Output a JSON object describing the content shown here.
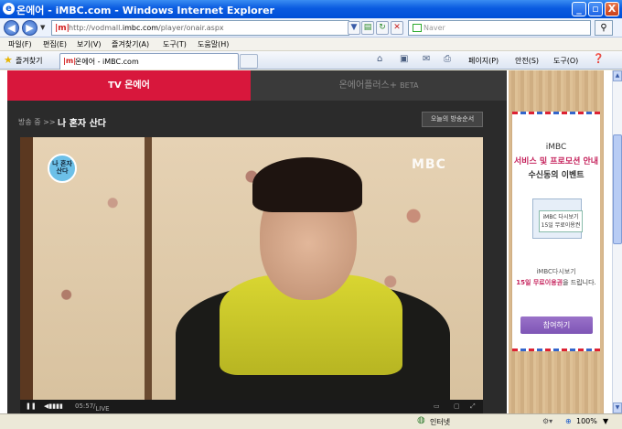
{
  "window": {
    "title": "온에어 - iMBC.com - Windows Internet Explorer",
    "minimize": "_",
    "maximize": "▫",
    "close": "X"
  },
  "address": {
    "url_prefix": "http://vodmall.",
    "url_domain": "imbc.com",
    "url_path": "/player/onair.aspx",
    "search_placeholder": "Naver"
  },
  "menu": [
    "파일(F)",
    "편집(E)",
    "보기(V)",
    "즐겨찾기(A)",
    "도구(T)",
    "도움말(H)"
  ],
  "favorites": {
    "label": "즐겨찾기",
    "tab_title": "온에어 - iMBC.com"
  },
  "command_bar": {
    "page": "페이지(P)",
    "safety": "안전(S)",
    "tools": "도구(O)"
  },
  "player": {
    "tab_tv": "TV 온에어",
    "tab_plus": "온에어플러스+",
    "tab_plus_badge": "BETA",
    "now_label": "방송 중 >>",
    "program_title": "나 혼자 산다",
    "schedule_button": "오늘의 방송순서",
    "logo": "MBC",
    "badge_text": "나 혼자 산다",
    "time": "05:57",
    "live": "LIVE"
  },
  "ad": {
    "brand": "iMBC",
    "title": "서비스 및 프로모션 안내",
    "subtitle": "수신동의 이벤트",
    "ticket_text": "iMBC 다시보기 15일 무료이용권",
    "line1": "iMBC다시보기",
    "line2_bold": "15일 무료이용권",
    "line2_rest": "을 드립니다.",
    "join_button": "참여하기"
  },
  "status": {
    "zone": "인터넷",
    "zoom": "100%"
  }
}
